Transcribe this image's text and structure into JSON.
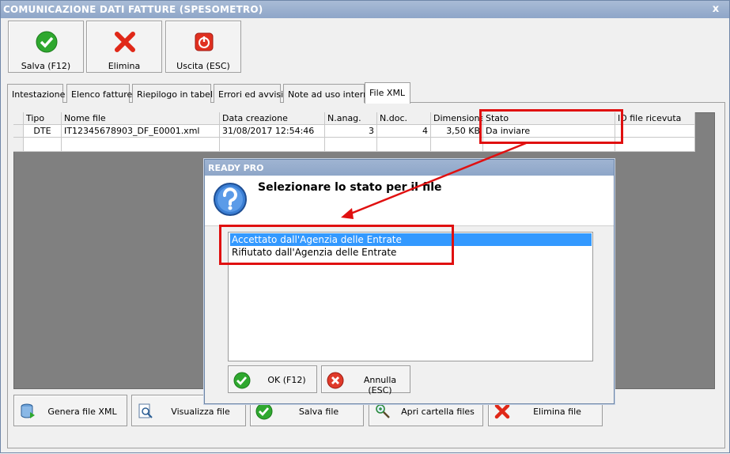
{
  "window": {
    "title": "COMUNICAZIONE DATI FATTURE (SPESOMETRO)",
    "close_glyph": "x"
  },
  "toolbar": {
    "save_label": "Salva (F12)",
    "delete_label": "Elimina",
    "exit_label": "Uscita (ESC)"
  },
  "tabs": [
    {
      "label": "Intestazione"
    },
    {
      "label": "Elenco fatture"
    },
    {
      "label": "Riepilogo in tabella"
    },
    {
      "label": "Errori ed avvisi"
    },
    {
      "label": "Note ad uso interno"
    },
    {
      "label": "File XML"
    }
  ],
  "grid": {
    "columns": [
      "Tipo",
      "Nome file",
      "Data creazione",
      "N.anag.",
      "N.doc.",
      "Dimensione",
      "Stato",
      "ID file ricevuta"
    ],
    "rows": [
      {
        "tipo": "DTE",
        "nome_file": "IT12345678903_DF_E0001.xml",
        "data": "31/08/2017 12:54:46",
        "n_anag": "3",
        "n_doc": "4",
        "dimensione": "3,50 KB",
        "stato": "Da inviare",
        "id": ""
      }
    ]
  },
  "dialog": {
    "title": "READY PRO",
    "message": "Selezionare lo stato per il file",
    "options": [
      "Accettato dall'Agenzia delle Entrate",
      "Rifiutato dall'Agenzia delle Entrate"
    ],
    "ok_label": "OK (F12)",
    "cancel_label": "Annulla (ESC)"
  },
  "bottom_buttons": {
    "generate": "Genera file XML",
    "view": "Visualizza file",
    "save": "Salva file",
    "open_folder": "Apri cartella files",
    "delete": "Elimina file"
  },
  "colors": {
    "highlight_red": "#e01010",
    "selection": "#3399ff",
    "title_bar": "#8ea6c8"
  }
}
